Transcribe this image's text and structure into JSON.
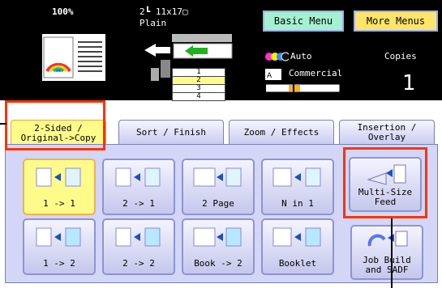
{
  "status": {
    "zoom": "100%",
    "paper_size": "2┗ 11x17▢",
    "paper_type": "Plain",
    "trays": [
      "1",
      "2",
      "3",
      "4"
    ],
    "color_mode": "Auto",
    "copies_label": "Copies",
    "copies_count": "1",
    "quality_mode": "Commercial"
  },
  "menus": {
    "basic": "Basic Menu",
    "more": "More Menus"
  },
  "tabs": [
    {
      "line1": "2-Sided /",
      "line2": "Original->Copy"
    },
    {
      "line1": "Sort / Finish",
      "line2": ""
    },
    {
      "line1": "Zoom / Effects",
      "line2": ""
    },
    {
      "line1": "Insertion /",
      "line2": "Overlay"
    }
  ],
  "options_row1": [
    "1 -> 1",
    "2 -> 1",
    "2 Page",
    "N in 1"
  ],
  "options_row2": [
    "1 -> 2",
    "2 -> 2",
    "Book -> 2",
    "Booklet"
  ],
  "side_buttons": {
    "multi_size": {
      "line1": "Multi-Size",
      "line2": "Feed"
    },
    "job_build": {
      "line1": "Job Build",
      "line2": "and SADF"
    }
  },
  "colors": {
    "accent_selected": "#fffb8a",
    "menu_more": "#ffe46b",
    "menu_basic": "#a5f0d0",
    "highlight": "#ff3300"
  }
}
